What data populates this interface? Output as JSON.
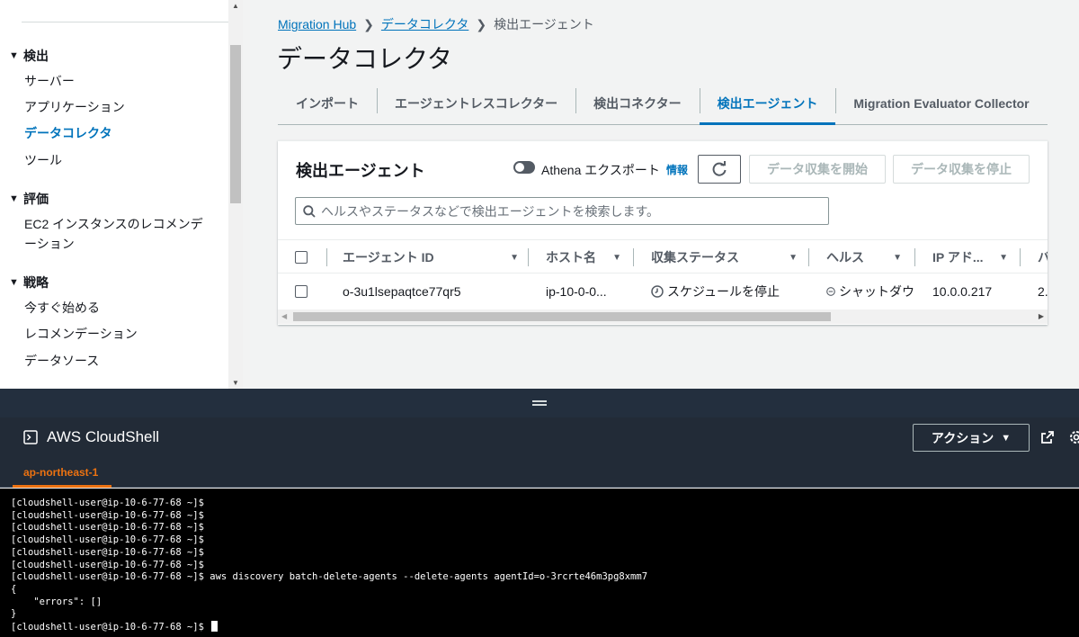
{
  "sidebar": {
    "sections": [
      {
        "label": "検出",
        "items": [
          {
            "label": "サーバー",
            "active": false
          },
          {
            "label": "アプリケーション",
            "active": false
          },
          {
            "label": "データコレクタ",
            "active": true
          },
          {
            "label": "ツール",
            "active": false
          }
        ]
      },
      {
        "label": "評価",
        "items": [
          {
            "label": "EC2 インスタンスのレコメンデーション",
            "active": false
          }
        ]
      },
      {
        "label": "戦略",
        "items": [
          {
            "label": "今すぐ始める",
            "active": false
          },
          {
            "label": "レコメンデーション",
            "active": false
          },
          {
            "label": "データソース",
            "active": false
          }
        ]
      }
    ]
  },
  "breadcrumb": {
    "items": [
      "Migration Hub",
      "データコレクタ"
    ],
    "current": "検出エージェント"
  },
  "page_title": "データコレクタ",
  "tabs": [
    {
      "label": "インポート",
      "active": false
    },
    {
      "label": "エージェントレスコレクター",
      "active": false
    },
    {
      "label": "検出コネクター",
      "active": false
    },
    {
      "label": "検出エージェント",
      "active": true
    },
    {
      "label": "Migration Evaluator Collector",
      "active": false
    }
  ],
  "panel": {
    "title": "検出エージェント",
    "athena_label": "Athena エクスポート",
    "info_label": "情報",
    "start_label": "データ収集を開始",
    "stop_label": "データ収集を停止",
    "search_placeholder": "ヘルスやステータスなどで検出エージェントを検索します。"
  },
  "table": {
    "columns": [
      "エージェント ID",
      "ホスト名",
      "収集ステータス",
      "ヘルス",
      "IP アド...",
      "バ"
    ],
    "rows": [
      {
        "agent_id": "o-3u1lsepaqtce77qr5",
        "host": "ip-10-0-0...",
        "status": "スケジュールを停止",
        "health": "シャットダウ",
        "ip": "10.0.0.217",
        "version": "2."
      }
    ]
  },
  "cloudshell": {
    "title": "AWS CloudShell",
    "action_label": "アクション",
    "region": "ap-northeast-1",
    "lines": [
      "[cloudshell-user@ip-10-6-77-68 ~]$",
      "[cloudshell-user@ip-10-6-77-68 ~]$",
      "[cloudshell-user@ip-10-6-77-68 ~]$",
      "[cloudshell-user@ip-10-6-77-68 ~]$",
      "[cloudshell-user@ip-10-6-77-68 ~]$",
      "[cloudshell-user@ip-10-6-77-68 ~]$",
      "[cloudshell-user@ip-10-6-77-68 ~]$ aws discovery batch-delete-agents --delete-agents agentId=o-3rcrte46m3pg8xmm7",
      "{",
      "    \"errors\": []",
      "}"
    ],
    "prompt": "[cloudshell-user@ip-10-6-77-68 ~]$ "
  },
  "colors": {
    "link": "#0073bb",
    "accent_orange": "#ec7211",
    "terminal_bg": "#000000",
    "cloudshell_header": "#222b37"
  }
}
